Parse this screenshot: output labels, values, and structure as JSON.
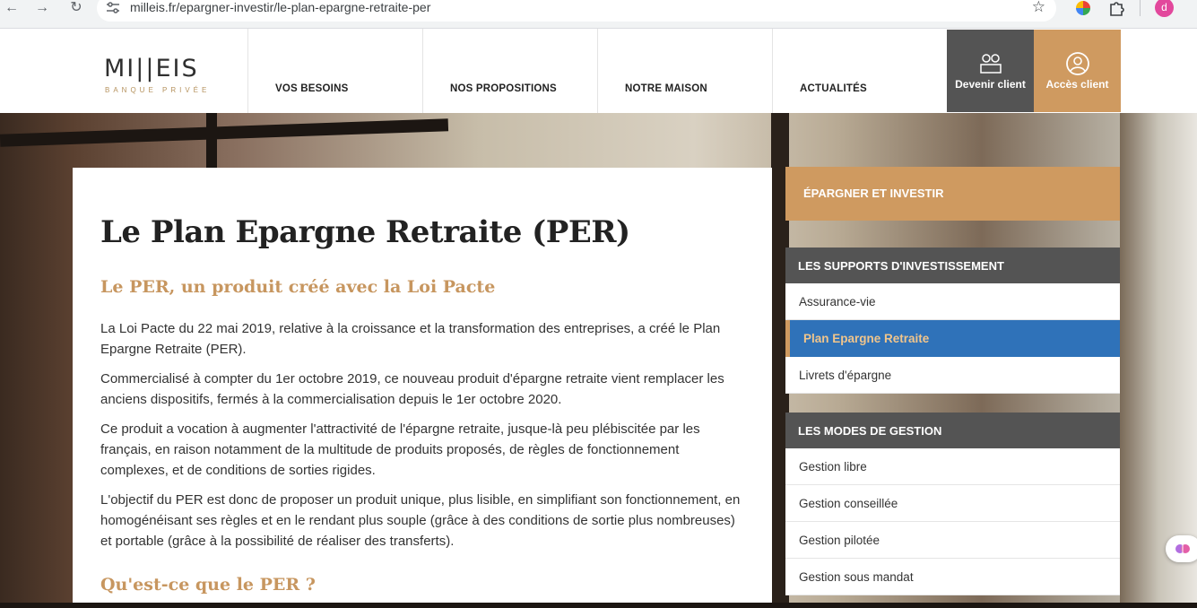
{
  "browser": {
    "url": "milleis.fr/epargner-investir/le-plan-epargne-retraite-per",
    "back_icon": "←",
    "forward_icon": "→",
    "reload_icon": "↻",
    "star_icon": "☆",
    "profile_letter": "d"
  },
  "header": {
    "logo_word": "MI||EIS",
    "logo_sub": "BANQUE  PRIVÉE",
    "nav": [
      "VOS BESOINS",
      "NOS PROPOSITIONS",
      "NOTRE MAISON",
      "ACTUALITÉS"
    ],
    "cta_new_client": "Devenir client",
    "cta_client_access": "Accès client"
  },
  "article": {
    "title": "Le Plan Epargne Retraite (PER)",
    "subtitle": "Le PER, un produit créé avec la Loi Pacte",
    "paragraphs": [
      "La Loi Pacte du 22 mai 2019, relative à la croissance et la transformation des entreprises, a créé le Plan Epargne Retraite (PER).",
      "Commercialisé à compter du 1er octobre 2019, ce nouveau produit d'épargne retraite vient remplacer les anciens dispositifs, fermés à la commercialisation depuis le 1er octobre 2020.",
      "Ce produit a vocation à augmenter l'attractivité de l'épargne retraite, jusque-là peu plébiscitée par les français, en raison notamment de la multitude de produits proposés, de règles de fonctionnement complexes, et de conditions de sorties rigides.",
      "L'objectif du PER est donc de proposer un produit unique, plus lisible, en simplifiant son fonctionnement, en homogénéisant ses règles et en le rendant plus souple (grâce à des conditions de sortie plus nombreuses) et portable (grâce à la possibilité de réaliser des transferts)."
    ],
    "subtitle2": "Qu'est-ce que le PER ?"
  },
  "sidebar": {
    "top_label": "ÉPARGNER ET INVESTIR",
    "group1_title": "LES SUPPORTS D'INVESTISSEMENT",
    "group1_items": [
      "Assurance-vie",
      "Plan Epargne Retraite",
      "Livrets d'épargne"
    ],
    "group2_title": "LES MODES DE GESTION",
    "group2_items": [
      "Gestion libre",
      "Gestion conseillée",
      "Gestion pilotée",
      "Gestion sous mandat"
    ]
  },
  "colors": {
    "gold": "#cf9a60",
    "dark_gray": "#545454",
    "active_blue": "#2f72b9"
  }
}
